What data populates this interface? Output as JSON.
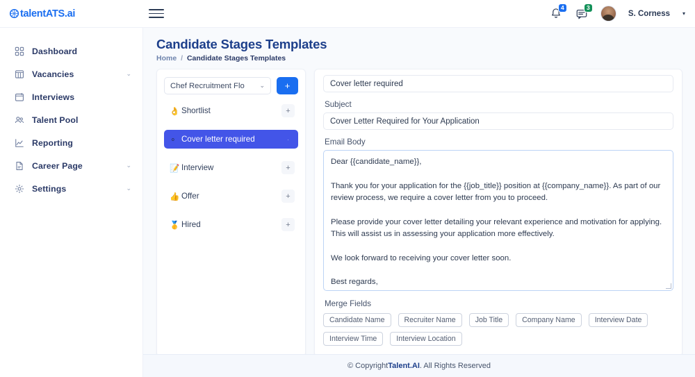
{
  "brand": {
    "name": "talentATS.ai",
    "accent": "#1a6ef0"
  },
  "topbar": {
    "menu_icon": "hamburger-icon",
    "notifications": {
      "icon": "bell-icon",
      "count": "4",
      "color": "#1a6ef0"
    },
    "messages": {
      "icon": "chat-icon",
      "count": "3",
      "color": "#14915a"
    },
    "user": {
      "name": "S. Corness",
      "caret": "▾"
    }
  },
  "sidebar": {
    "items": [
      {
        "label": "Dashboard",
        "icon": "grid-icon",
        "expandable": false
      },
      {
        "label": "Vacancies",
        "icon": "columns-icon",
        "expandable": true,
        "chev": "⌄"
      },
      {
        "label": "Interviews",
        "icon": "calendar-icon",
        "expandable": false
      },
      {
        "label": "Talent Pool",
        "icon": "users-icon",
        "expandable": false
      },
      {
        "label": "Reporting",
        "icon": "chart-icon",
        "expandable": false
      },
      {
        "label": "Career Page",
        "icon": "file-icon",
        "expandable": true,
        "chev": "⌄"
      },
      {
        "label": "Settings",
        "icon": "gear-icon",
        "expandable": true,
        "chev": "⌄"
      }
    ]
  },
  "page": {
    "title": "Candidate Stages Templates",
    "breadcrumb": {
      "home": "Home",
      "separator": "/",
      "current": "Candidate Stages Templates"
    }
  },
  "stage_panel": {
    "flow_select": {
      "value": "Chef Recruitment Flo",
      "chevron": "⌄"
    },
    "add_flow_button": "+",
    "stages": [
      {
        "emoji": "👌",
        "label": "Shortlist",
        "action": "+",
        "selected": false
      },
      {
        "emoji": "⚬",
        "label": "Cover letter required",
        "action": "·",
        "selected": true
      },
      {
        "emoji": "📝",
        "label": "Interview",
        "action": "+",
        "selected": false
      },
      {
        "emoji": "👍",
        "label": "Offer",
        "action": "+",
        "selected": false
      },
      {
        "emoji": "🥇",
        "label": "Hired",
        "action": "+",
        "selected": false
      }
    ]
  },
  "form": {
    "stage_name_value": "Cover letter required",
    "subject_label": "Subject",
    "subject_value": "Cover Letter Required for Your Application",
    "body_label": "Email Body",
    "body_value": "Dear {{candidate_name}},\n\nThank you for your application for the {{job_title}} position at {{company_name}}. As part of our review process, we require a cover letter from you to proceed.\n\nPlease provide your cover letter detailing your relevant experience and motivation for applying. This will assist us in assessing your application more effectively.\n\nWe look forward to receiving your cover letter soon.\n\nBest regards,\n{{recruiter_name}}",
    "merge_fields_label": "Merge Fields",
    "merge_fields": [
      "Candidate Name",
      "Recruiter Name",
      "Job Title",
      "Company Name",
      "Interview Date",
      "Interview Time",
      "Interview Location"
    ]
  },
  "footer": {
    "prefix": "© Copyright ",
    "brand": "Talent.AI",
    "suffix": ". All Rights Reserved"
  }
}
